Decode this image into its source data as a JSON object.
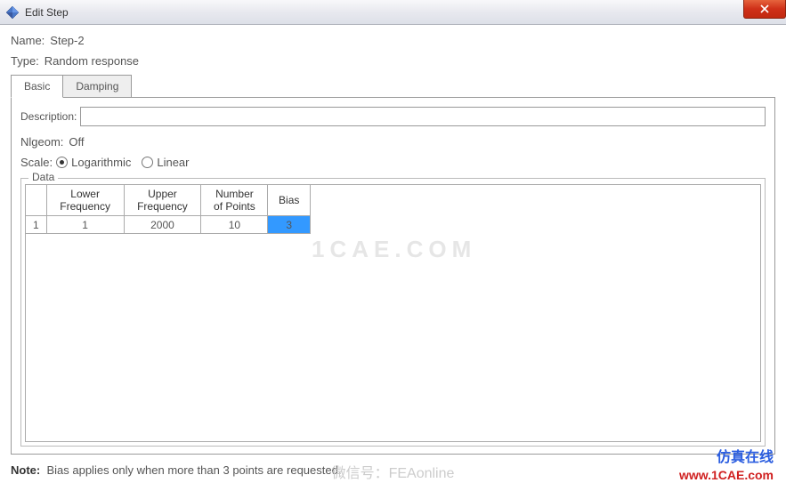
{
  "titlebar": {
    "title": "Edit Step"
  },
  "form": {
    "name_label": "Name:",
    "name_value": "Step-2",
    "type_label": "Type:",
    "type_value": "Random response"
  },
  "tabs": {
    "basic": "Basic",
    "damping": "Damping"
  },
  "basic": {
    "description_label": "Description:",
    "description_value": "",
    "nlgeom_label": "Nlgeom:",
    "nlgeom_value": "Off",
    "scale_label": "Scale:",
    "scale_options": {
      "logarithmic": "Logarithmic",
      "linear": "Linear"
    },
    "data_legend": "Data",
    "table": {
      "headers": {
        "lower": "Lower\nFrequency",
        "upper": "Upper\nFrequency",
        "points": "Number\nof Points",
        "bias": "Bias"
      },
      "rows": [
        {
          "n": "1",
          "lower": "1",
          "upper": "2000",
          "points": "10",
          "bias": "3"
        }
      ]
    }
  },
  "note": {
    "label": "Note:",
    "text": "Bias applies only when more than 3 points are requested."
  },
  "watermarks": {
    "logo": "1CAE.COM",
    "center": "微信号：FEAonline",
    "cn": "仿真在线",
    "url": "www.1CAE.com"
  }
}
